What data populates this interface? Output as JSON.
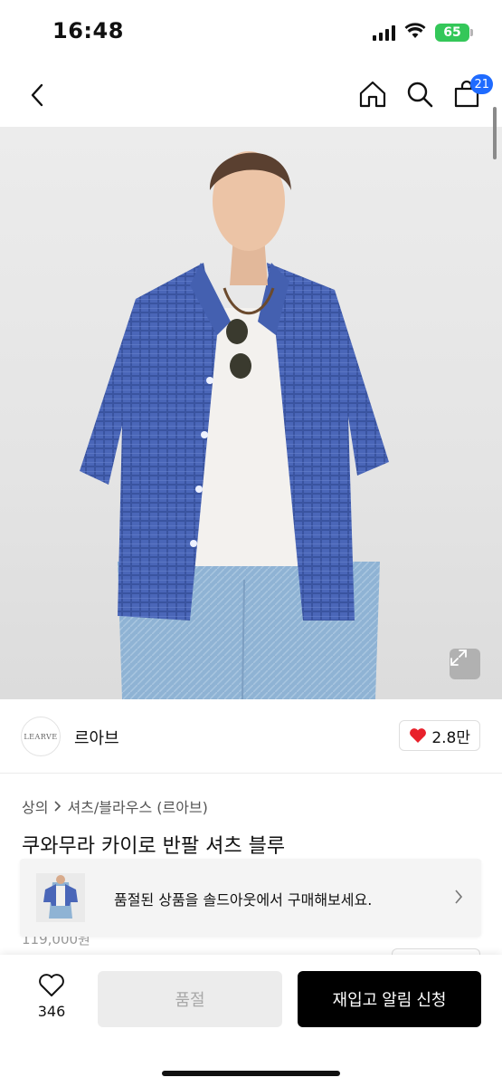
{
  "status_bar": {
    "time": "16:48",
    "battery_level": "65",
    "icons": [
      "signal-icon",
      "wifi-icon",
      "battery-icon"
    ]
  },
  "nav": {
    "icons": [
      "back-chevron-icon",
      "home-icon",
      "search-icon",
      "cart-icon"
    ],
    "cart_count": "21"
  },
  "hero": {
    "alt": "product-photo-model-wearing-blue-check-shirt",
    "expand_icon": "expand-arrows-icon"
  },
  "brand": {
    "logo_text": "LEARVE",
    "name": "르아브",
    "like_count": "2.8만",
    "like_icon": "heart-filled-icon"
  },
  "breadcrumb": {
    "category": "상의",
    "separator_icon": "chevron-right-icon",
    "subcategory": "셔츠/블라우스 (르아브)"
  },
  "product": {
    "title": "쿠와무라 카이로 반팔 셔츠 블루",
    "price_partial": "119,000원"
  },
  "soldout_banner": {
    "text": "품절된 상품을 솔드아웃에서 구매해보세요.",
    "chevron_icon": "chevron-right-icon"
  },
  "bottom_bar": {
    "wish_icon": "heart-outline-icon",
    "wish_count": "346",
    "soldout_label": "품절",
    "restock_label": "재입고 알림 신청"
  },
  "colors": {
    "accent_blue": "#1f6bff",
    "battery_green": "#34c759",
    "heart_red": "#e8212b",
    "primary_black": "#000000",
    "disabled_gray": "#ececec"
  }
}
